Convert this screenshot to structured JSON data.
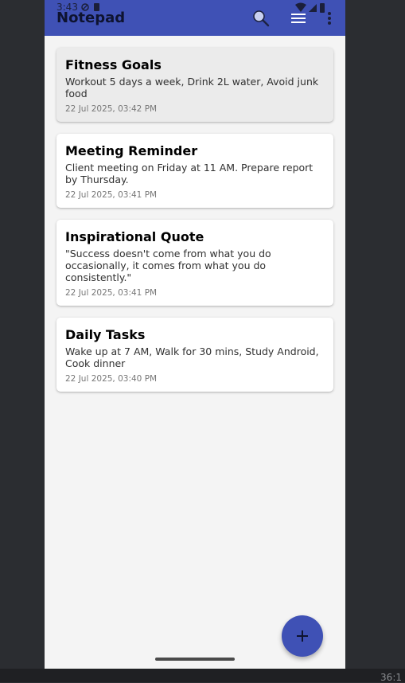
{
  "status_bar": {
    "time": "3:43"
  },
  "app_bar": {
    "title": "Notepad",
    "icons": [
      "search-icon",
      "menu-icon",
      "more-vert-icon"
    ]
  },
  "notes": [
    {
      "title": "Fitness Goals",
      "body": "Workout 5 days a week, Drink 2L water, Avoid junk food",
      "date": "22 Jul 2025, 03:42 PM",
      "selected": true
    },
    {
      "title": "Meeting Reminder",
      "body": "Client meeting on Friday at 11 AM. Prepare report by Thursday.",
      "date": "22 Jul 2025, 03:41 PM",
      "selected": false
    },
    {
      "title": "Inspirational Quote",
      "body": "\"Success doesn't come from what you do occasionally, it comes from what you do consistently.\"",
      "date": "22 Jul 2025, 03:41 PM",
      "selected": false
    },
    {
      "title": "Daily Tasks",
      "body": "Wake up at 7 AM, Walk for 30 mins, Study Android, Cook dinner",
      "date": "22 Jul 2025, 03:40 PM",
      "selected": false
    }
  ],
  "fab": {
    "icon": "plus-icon"
  },
  "emulator": {
    "corner_text": "36:1"
  },
  "colors": {
    "primary": "#3f51b5",
    "background": "#f4f4f4",
    "card": "#ffffff",
    "card_selected": "#ebebeb"
  }
}
